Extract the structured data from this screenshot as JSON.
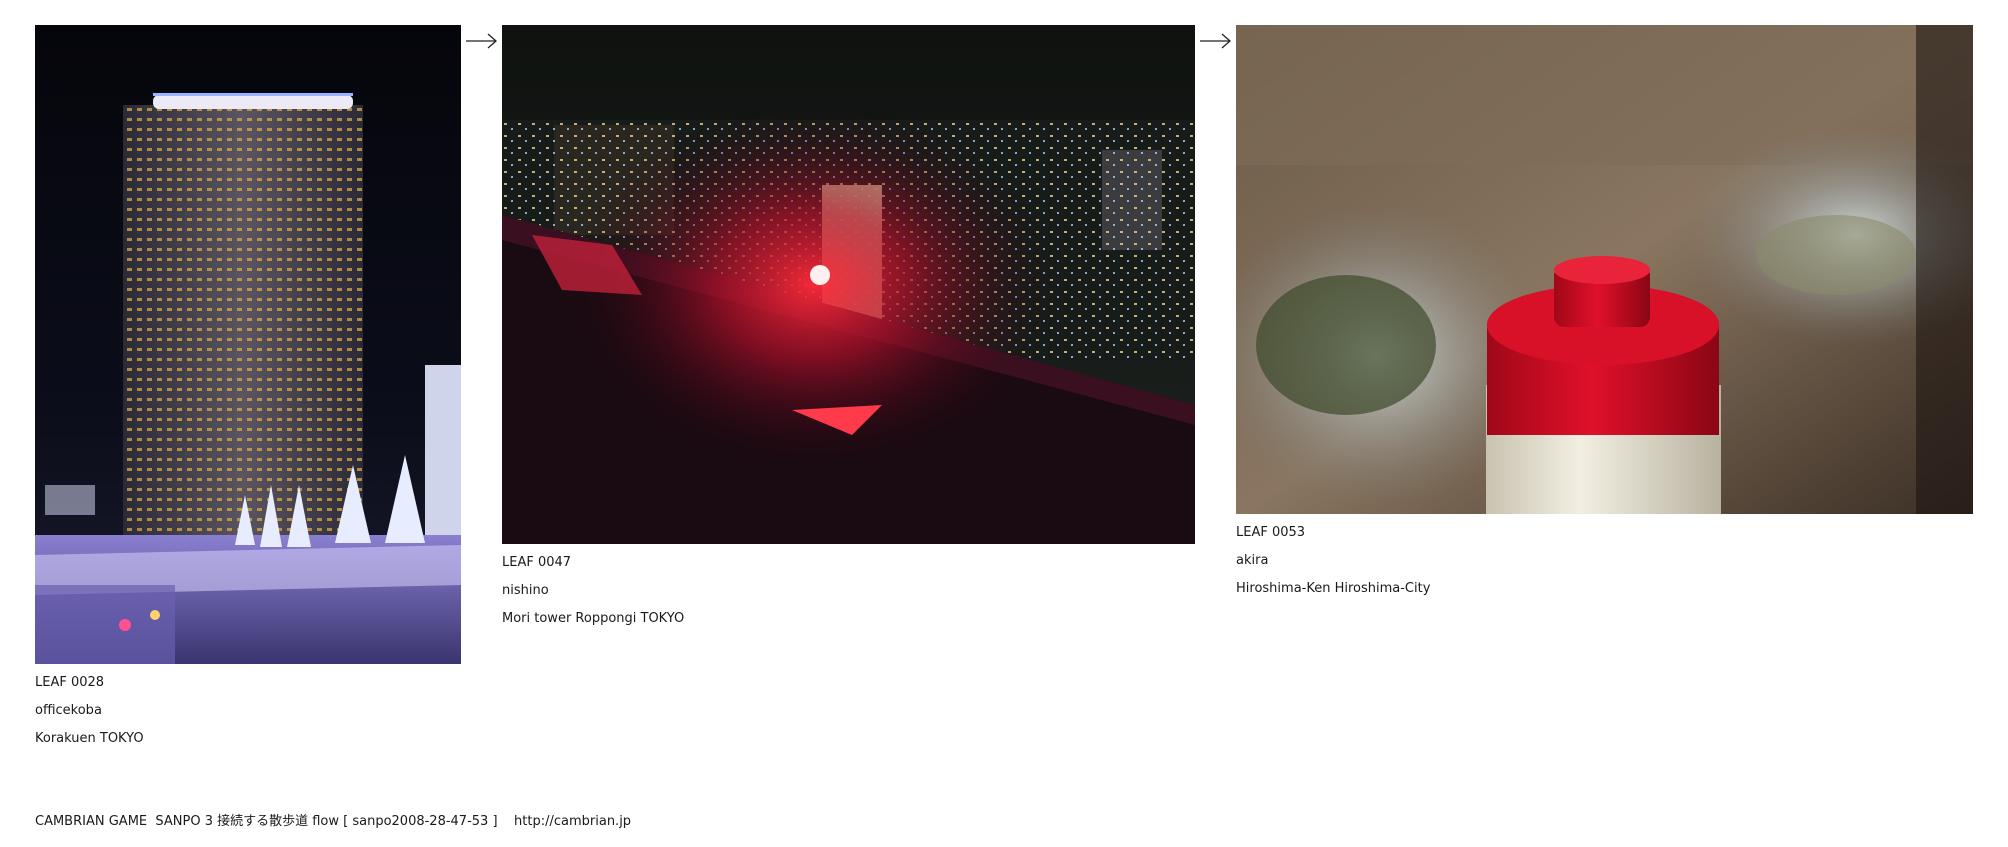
{
  "leaves": [
    {
      "id": "LEAF 0028",
      "author": "officekoba",
      "location": "Korakuen TOKYO",
      "photo_icon": "night-hotel-tower-photo"
    },
    {
      "id": "LEAF 0047",
      "author": "nishino",
      "location": "Mori tower Roppongi TOKYO",
      "photo_icon": "night-city-rooftop-photo"
    },
    {
      "id": "LEAF 0053",
      "author": "akira",
      "location": "Hiroshima-Ken Hiroshima-City",
      "photo_icon": "red-cap-bottle-photo"
    }
  ],
  "arrows": {
    "glyph": "→"
  },
  "footer": {
    "text": "CAMBRIAN GAME  SANPO 3 接続する散歩道 flow [ sanpo2008-28-47-53 ]    http://cambrian.jp"
  },
  "colors": {
    "accent_red": "#e0102a",
    "night_sky": "#05060b"
  }
}
